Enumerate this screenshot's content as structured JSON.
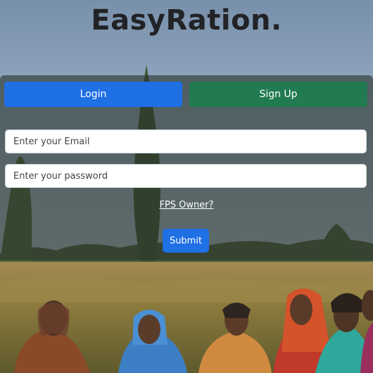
{
  "brand": {
    "name": "EasyRation."
  },
  "tabs": {
    "login_label": "Login",
    "signup_label": "Sign Up"
  },
  "form": {
    "email_placeholder": "Enter your Email",
    "password_placeholder": "Enter your password",
    "fps_owner_link": "FPS Owner?",
    "submit_label": "Submit"
  },
  "colors": {
    "login_tab": "#1f6fe5",
    "signup_tab": "#227a51",
    "submit_button": "#1f6fe5"
  },
  "background": {
    "subject": "group of rural women seated in a field under a blue sky"
  }
}
